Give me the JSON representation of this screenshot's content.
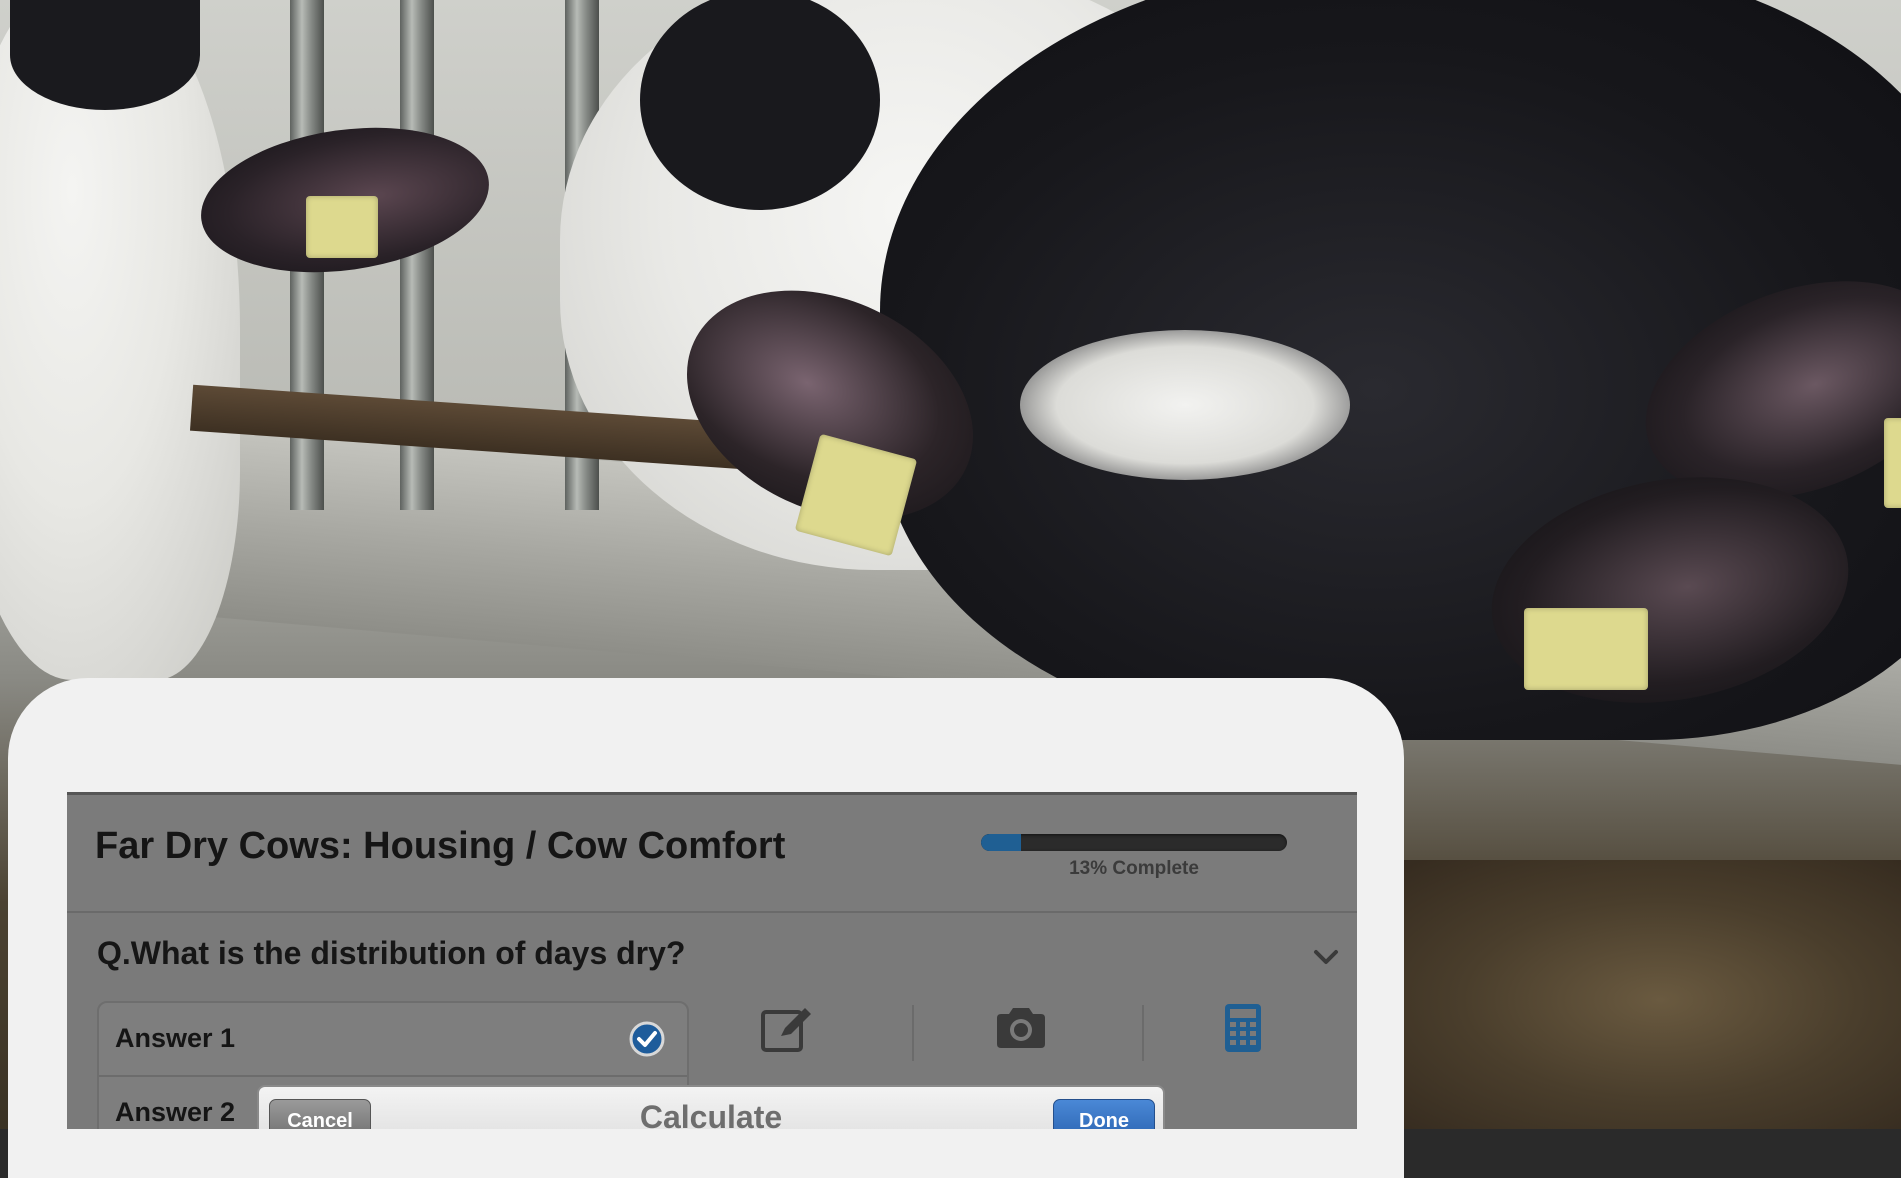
{
  "survey": {
    "title": "Far Dry Cows: Housing / Cow Comfort",
    "progress_fraction": 0.13,
    "progress_label": "13% Complete",
    "question": "Q.What is the distribution of days dry?",
    "answers": [
      {
        "label": "Answer 1",
        "selected": true
      },
      {
        "label": "Answer 2",
        "selected": false
      }
    ],
    "tools": [
      "edit-note-icon",
      "camera-icon",
      "calculator-icon"
    ]
  },
  "calculate_popover": {
    "title": "Calculate",
    "cancel_label": "Cancel",
    "done_label": "Done"
  },
  "colors": {
    "progress_fill": "#1f5f93",
    "done_button": "#2a63b0",
    "check_badge": "#1e5c9b",
    "calculator_icon": "#1f5f93"
  }
}
